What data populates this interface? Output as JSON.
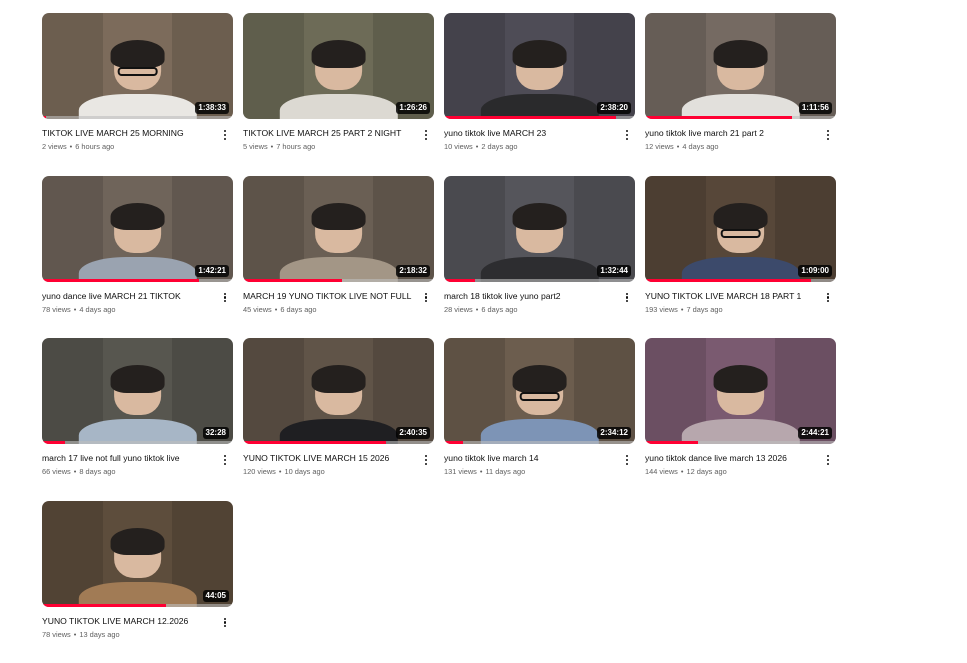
{
  "videos": [
    {
      "title": "TIKTOK LIVE MARCH 25 MORNING",
      "views": "2 views",
      "age": "6 hours ago",
      "duration": "1:38:33",
      "progress": 0.02,
      "bg": "#7c6b5b",
      "body": "#e9e7e3",
      "glasses": true
    },
    {
      "title": "TIKTOK LIVE MARCH 25 PART 2 NIGHT",
      "views": "5 views",
      "age": "7 hours ago",
      "duration": "1:26:26",
      "progress": 0.0,
      "bg": "#6d6b57",
      "body": "#dcd9d2",
      "glasses": false
    },
    {
      "title": "yuno tiktok live MARCH 23",
      "views": "10 views",
      "age": "2 days ago",
      "duration": "2:38:20",
      "progress": 0.9,
      "bg": "#4e4c56",
      "body": "#2a2a2c",
      "glasses": false
    },
    {
      "title": "yuno tiktok live march 21 part 2",
      "views": "12 views",
      "age": "4 days ago",
      "duration": "1:11:56",
      "progress": 0.77,
      "bg": "#756a62",
      "body": "#e2e0dc",
      "glasses": false
    },
    {
      "title": "yuno dance live MARCH 21 TIKTOK",
      "views": "78 views",
      "age": "4 days ago",
      "duration": "1:42:21",
      "progress": 0.82,
      "bg": "#6f645a",
      "body": "#9aa3b0",
      "glasses": false
    },
    {
      "title": "MARCH 19 YUNO TIKTOK LIVE NOT FULL",
      "views": "45 views",
      "age": "6 days ago",
      "duration": "2:18:32",
      "progress": 0.52,
      "bg": "#6a5f54",
      "body": "#a39686",
      "glasses": false
    },
    {
      "title": "march 18 tiktok live yuno part2",
      "views": "28 views",
      "age": "6 days ago",
      "duration": "1:32:44",
      "progress": 0.16,
      "bg": "#55555b",
      "body": "#2d2d30",
      "glasses": false
    },
    {
      "title": "YUNO TIKTOK LIVE MARCH 18 PART 1",
      "views": "193 views",
      "age": "7 days ago",
      "duration": "1:09:00",
      "progress": 0.87,
      "bg": "#574739",
      "body": "#3c4a6b",
      "glasses": true
    },
    {
      "title": "march 17 live not full yuno tiktok live",
      "views": "66 views",
      "age": "8 days ago",
      "duration": "32:28",
      "progress": 0.12,
      "bg": "#57564f",
      "body": "#a7b6c6",
      "glasses": false
    },
    {
      "title": "YUNO TIKTOK LIVE MARCH 15 2026",
      "views": "120 views",
      "age": "10 days ago",
      "duration": "2:40:35",
      "progress": 0.75,
      "bg": "#605448",
      "body": "#1f1f22",
      "glasses": false
    },
    {
      "title": "yuno tiktok live march 14",
      "views": "131 views",
      "age": "11 days ago",
      "duration": "2:34:12",
      "progress": 0.1,
      "bg": "#6c5d4e",
      "body": "#7d94b6",
      "glasses": true
    },
    {
      "title": "yuno tiktok dance live march 13 2026",
      "views": "144 views",
      "age": "12 days ago",
      "duration": "2:44:21",
      "progress": 0.28,
      "bg": "#7a5a70",
      "body": "#b7a7ad",
      "glasses": false
    },
    {
      "title": "YUNO TIKTOK LIVE MARCH 12.2026",
      "views": "78 views",
      "age": "13 days ago",
      "duration": "44:05",
      "progress": 0.65,
      "bg": "#5d4d3c",
      "body": "#a17b55",
      "glasses": false
    }
  ],
  "separator": "•",
  "colors": {
    "accent": "#ff0033",
    "meta_text": "#606060",
    "title_text": "#0f0f0f"
  },
  "icons": {
    "more": "more-vert-icon"
  }
}
